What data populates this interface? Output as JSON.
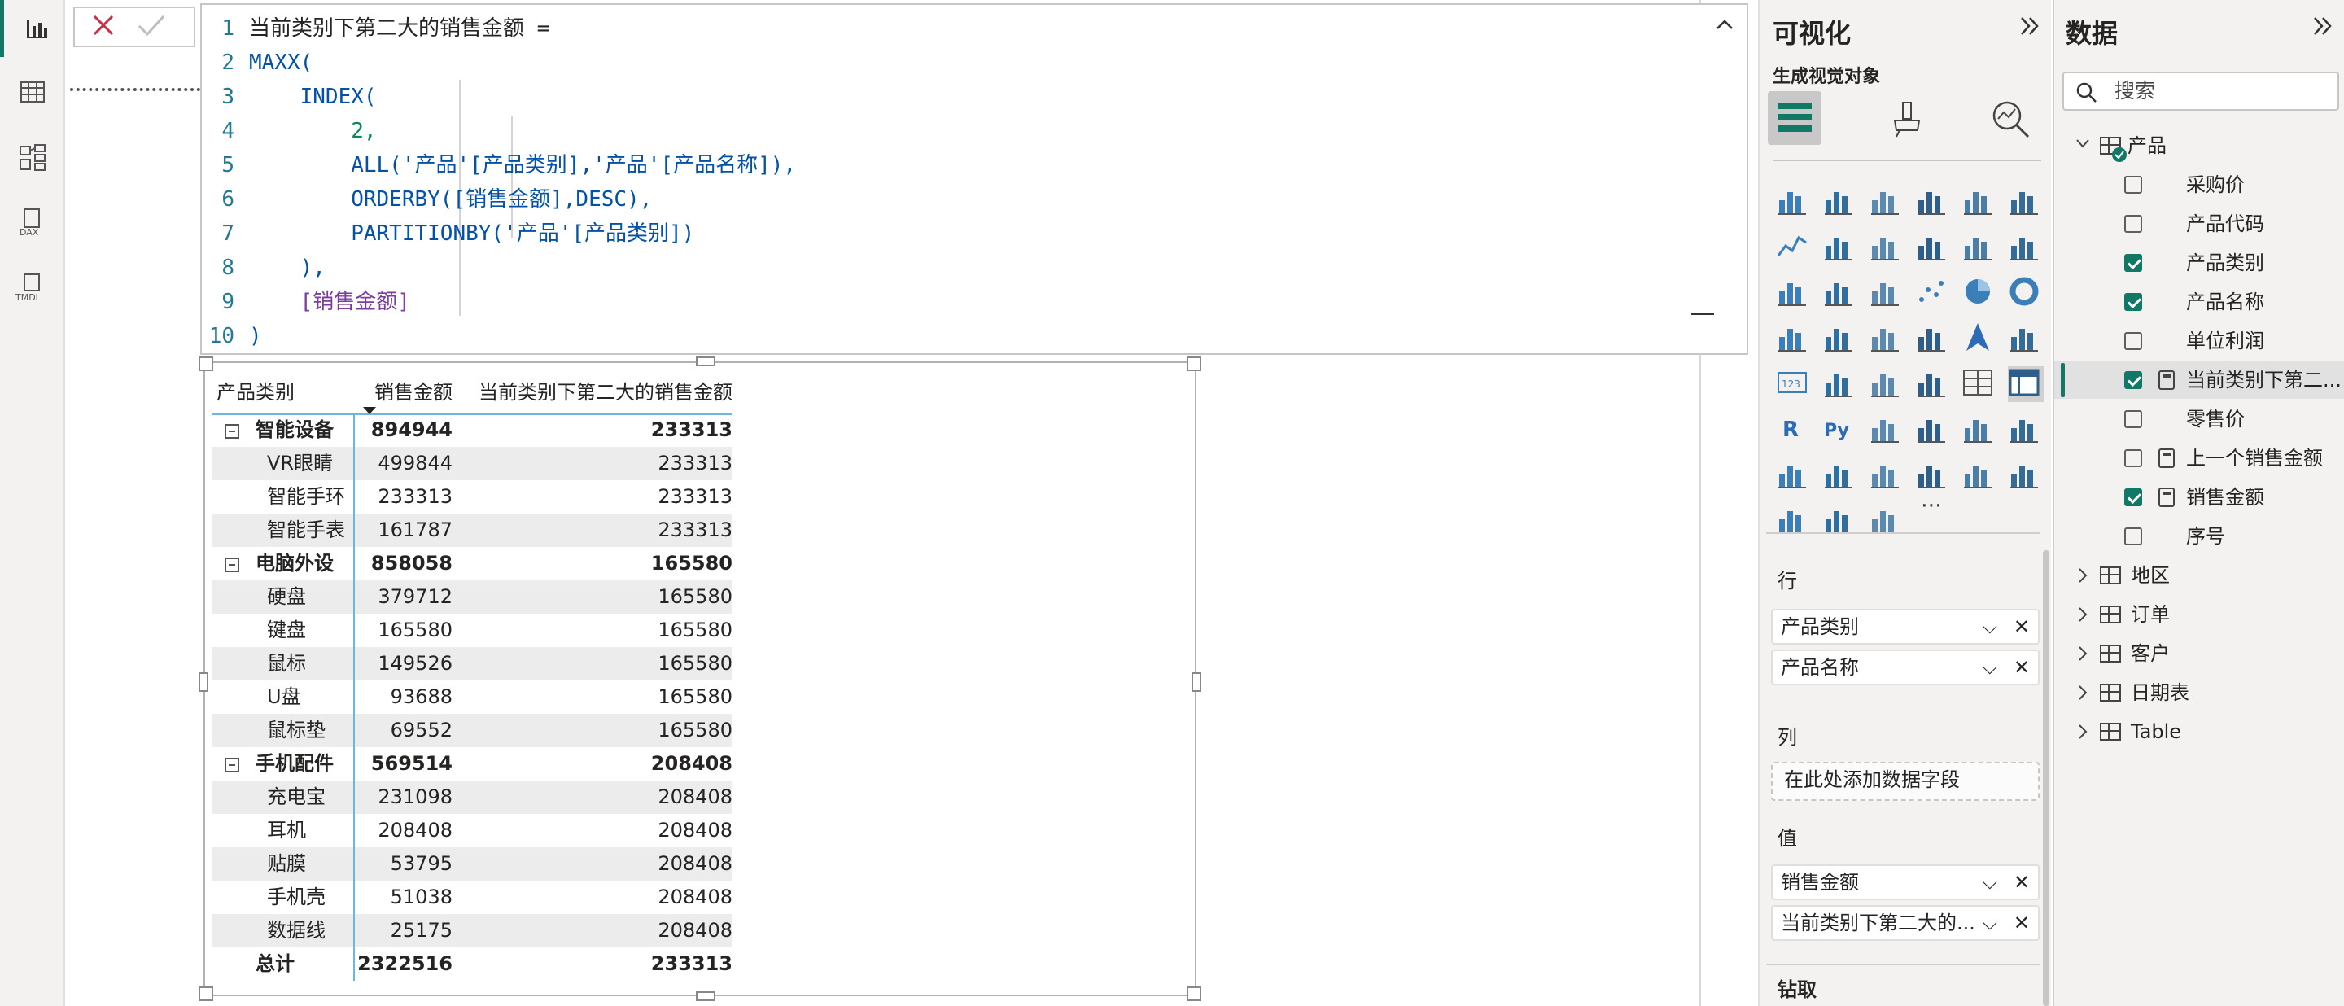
{
  "rail": {
    "items": [
      {
        "name": "report-view",
        "icon": "bar-chart-icon",
        "active": true
      },
      {
        "name": "table-view",
        "icon": "table-grid-icon",
        "active": false
      },
      {
        "name": "model-view",
        "icon": "model-icon",
        "active": false
      },
      {
        "name": "dax-query-view",
        "icon": "dax-icon",
        "label": "DAX",
        "active": false
      },
      {
        "name": "tmdl-view",
        "icon": "tmdl-icon",
        "label": "TMDL",
        "active": false
      }
    ]
  },
  "formula": {
    "lines": [
      {
        "no": "1",
        "text": "当前类别下第二大的销售金额 ="
      },
      {
        "no": "2",
        "text": "MAXX("
      },
      {
        "no": "3",
        "text": "    INDEX("
      },
      {
        "no": "4",
        "text": "        2,"
      },
      {
        "no": "5",
        "text": "        ALL('产品'[产品类别],'产品'[产品名称]),"
      },
      {
        "no": "6",
        "text": "        ORDERBY([销售金额],DESC),"
      },
      {
        "no": "7",
        "text": "        PARTITIONBY('产品'[产品类别])"
      },
      {
        "no": "8",
        "text": "    ),"
      },
      {
        "no": "9",
        "text": "    [销售金额]"
      },
      {
        "no": "10",
        "text": ")"
      }
    ]
  },
  "matrix": {
    "headers": [
      "产品类别",
      "销售金额",
      "当前类别下第二大的销售金额"
    ],
    "rows": [
      {
        "type": "group",
        "label": "智能设备",
        "sales": "894944",
        "second": "233313"
      },
      {
        "type": "item",
        "label": "VR眼睛",
        "sales": "499844",
        "second": "233313"
      },
      {
        "type": "item",
        "label": "智能手环",
        "sales": "233313",
        "second": "233313"
      },
      {
        "type": "item",
        "label": "智能手表",
        "sales": "161787",
        "second": "233313"
      },
      {
        "type": "group",
        "label": "电脑外设",
        "sales": "858058",
        "second": "165580"
      },
      {
        "type": "item",
        "label": "硬盘",
        "sales": "379712",
        "second": "165580"
      },
      {
        "type": "item",
        "label": "键盘",
        "sales": "165580",
        "second": "165580"
      },
      {
        "type": "item",
        "label": "鼠标",
        "sales": "149526",
        "second": "165580"
      },
      {
        "type": "item",
        "label": "U盘",
        "sales": "93688",
        "second": "165580"
      },
      {
        "type": "item",
        "label": "鼠标垫",
        "sales": "69552",
        "second": "165580"
      },
      {
        "type": "group",
        "label": "手机配件",
        "sales": "569514",
        "second": "208408"
      },
      {
        "type": "item",
        "label": "充电宝",
        "sales": "231098",
        "second": "208408"
      },
      {
        "type": "item",
        "label": "耳机",
        "sales": "208408",
        "second": "208408"
      },
      {
        "type": "item",
        "label": "贴膜",
        "sales": "53795",
        "second": "208408"
      },
      {
        "type": "item",
        "label": "手机壳",
        "sales": "51038",
        "second": "208408"
      },
      {
        "type": "item",
        "label": "数据线",
        "sales": "25175",
        "second": "208408"
      },
      {
        "type": "total",
        "label": "总计",
        "sales": "2322516",
        "second": "233313"
      }
    ]
  },
  "viz": {
    "title": "可视化",
    "subtitle": "生成视觉对象",
    "rows_label": "行",
    "rows_fields": [
      "产品类别",
      "产品名称"
    ],
    "cols_label": "列",
    "cols_placeholder": "在此处添加数据字段",
    "values_label": "值",
    "values_fields": [
      "销售金额",
      "当前类别下第二大的..."
    ],
    "drill_label": "钻取",
    "more": "⋯"
  },
  "data": {
    "title": "数据",
    "search_placeholder": "搜索",
    "table_name": "产品",
    "fields": [
      {
        "label": "采购价",
        "checked": false,
        "calc": false
      },
      {
        "label": "产品代码",
        "checked": false,
        "calc": false
      },
      {
        "label": "产品类别",
        "checked": true,
        "calc": false
      },
      {
        "label": "产品名称",
        "checked": true,
        "calc": false
      },
      {
        "label": "单位利润",
        "checked": false,
        "calc": false
      },
      {
        "label": "当前类别下第二...",
        "checked": true,
        "calc": true
      },
      {
        "label": "零售价",
        "checked": false,
        "calc": false
      },
      {
        "label": "上一个销售金额",
        "checked": false,
        "calc": true
      },
      {
        "label": "销售金额",
        "checked": true,
        "calc": true
      },
      {
        "label": "序号",
        "checked": false,
        "calc": false
      }
    ],
    "tables": [
      "地区",
      "订单",
      "客户",
      "日期表",
      "Table"
    ]
  },
  "colors": {
    "accent": "#117865",
    "code_keyword": "#0451a5",
    "code_measure": "#7a3e9d"
  }
}
